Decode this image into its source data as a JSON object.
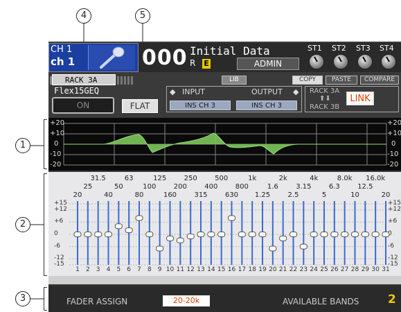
{
  "callouts": {
    "c4": "4",
    "c5": "5",
    "c1": "1",
    "c2": "2",
    "c3": "3"
  },
  "channel": {
    "number": "CH 1",
    "name": "ch 1"
  },
  "scene": {
    "number": "000",
    "title": "Initial Data",
    "re": "R",
    "edit_badge": "E",
    "user": "ADMIN"
  },
  "stereo": {
    "labels": [
      "ST1",
      "ST2",
      "ST3",
      "ST4"
    ]
  },
  "rack": {
    "tab": "RACK 3A",
    "effect": "Flex15GEQ",
    "on": "ON",
    "flat": "FLAT",
    "lib": "LIB",
    "copy": "COPY",
    "paste": "PASTE",
    "compare": "COMPARE",
    "input_label": "INPUT",
    "output_label": "OUTPUT",
    "input_patch": "INS CH 3",
    "output_patch": "INS CH 3",
    "link_top": "RACK 3A",
    "link_bottom": "RACK 3B",
    "link": "LINK"
  },
  "graph": {
    "left_ticks": [
      "+20",
      "+10",
      "0",
      "-10",
      "-20"
    ],
    "right_ticks": [
      "+20",
      "+10",
      "0",
      "-10",
      "-20"
    ]
  },
  "faders": {
    "freq_row1": [
      "31.5",
      "63",
      "125",
      "250",
      "500",
      "1k",
      "2k",
      "4k",
      "8.0k",
      "16.0k"
    ],
    "freq_row2": [
      "25",
      "50",
      "100",
      "200",
      "400",
      "800",
      "1.6",
      "3.15",
      "6.3",
      "12.5"
    ],
    "freq_row3": [
      "20",
      "40",
      "80",
      "160",
      "315",
      "630",
      "1.25",
      "2.5",
      "5",
      "10",
      "20"
    ],
    "left_ticks": [
      "+15",
      "+12",
      "+6",
      "0",
      "-6",
      "-12",
      "-15"
    ],
    "right_ticks": [
      "+15",
      "+12",
      "+6",
      "0",
      "-6",
      "-12",
      "-15"
    ],
    "band_numbers": [
      "1",
      "2",
      "3",
      "4",
      "5",
      "6",
      "7",
      "8",
      "9",
      "10",
      "11",
      "12",
      "13",
      "14",
      "15",
      "16",
      "17",
      "18",
      "19",
      "20",
      "21",
      "22",
      "23",
      "24",
      "25",
      "26",
      "27",
      "28",
      "29",
      "30",
      "31"
    ],
    "gains_db": [
      0,
      0,
      0,
      0,
      4,
      2,
      8,
      0,
      -7,
      -2,
      -3,
      -1,
      0,
      0,
      0,
      8,
      0,
      0,
      0,
      -7,
      -2,
      0,
      -6,
      0,
      0,
      0,
      0,
      0,
      0,
      0,
      0
    ]
  },
  "assign": {
    "fader_assign_label": "FADER ASSIGN",
    "range": "20-20k",
    "available_label": "AVAILABLE BANDS",
    "available_value": "2"
  },
  "colors": {
    "accent_orange": "#e04000",
    "graph_fill": "#7cc85a",
    "fader_line": "#3a6ad0",
    "edit_yellow": "#e8c800"
  }
}
